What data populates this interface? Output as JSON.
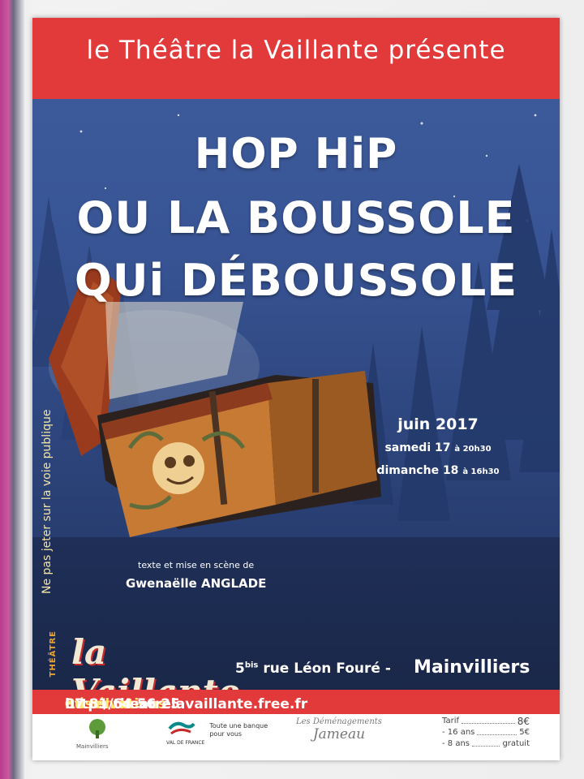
{
  "header": {
    "banner": "le Théâtre la Vaillante présente"
  },
  "title": {
    "line1": "HOP HiP",
    "line2": "OU LA BOUSSOLE",
    "line3": "QUi DÉBOUSSOLE"
  },
  "side_note": "Ne pas jeter sur la voie publique",
  "dates": {
    "month": "juin 2017",
    "day1_label": "samedi 17",
    "day1_time": "à 20h30",
    "day2_label": "dimanche 18",
    "day2_time": "à 16h30"
  },
  "credits": {
    "label": "texte et mise en scène de",
    "author_first": "Gwenaëlle",
    "author_last": "ANGLADE"
  },
  "logo": {
    "small": "THÉÂTRE",
    "main": "la Vaillante"
  },
  "address": {
    "number": "5",
    "sup": "bis",
    "street": "rue Léon Fouré -",
    "city": "Mainvilliers"
  },
  "reservations": {
    "label": "Réservations :",
    "url": "http://theatrelavaillante.free.fr",
    "or": "ou tél. :",
    "phone": "07 81 64 56 25"
  },
  "sponsors": {
    "cde": "Mainvilliers",
    "ca_name": "VAL DE FRANCE",
    "ca_slogan1": "Toute une banque",
    "ca_slogan2": "pour vous",
    "dem1": "Les Déménagements",
    "dem2": "Jameau"
  },
  "tarif": {
    "title": "Tarif",
    "rows": [
      {
        "label": "Tarif",
        "price": "8€"
      },
      {
        "label": "- 16 ans",
        "price": "5€"
      },
      {
        "label": "- 8 ans",
        "price": "gratuit"
      }
    ]
  },
  "colors": {
    "banner": "#e23a3a",
    "sky": "#385494",
    "accent": "#ffe96a"
  }
}
